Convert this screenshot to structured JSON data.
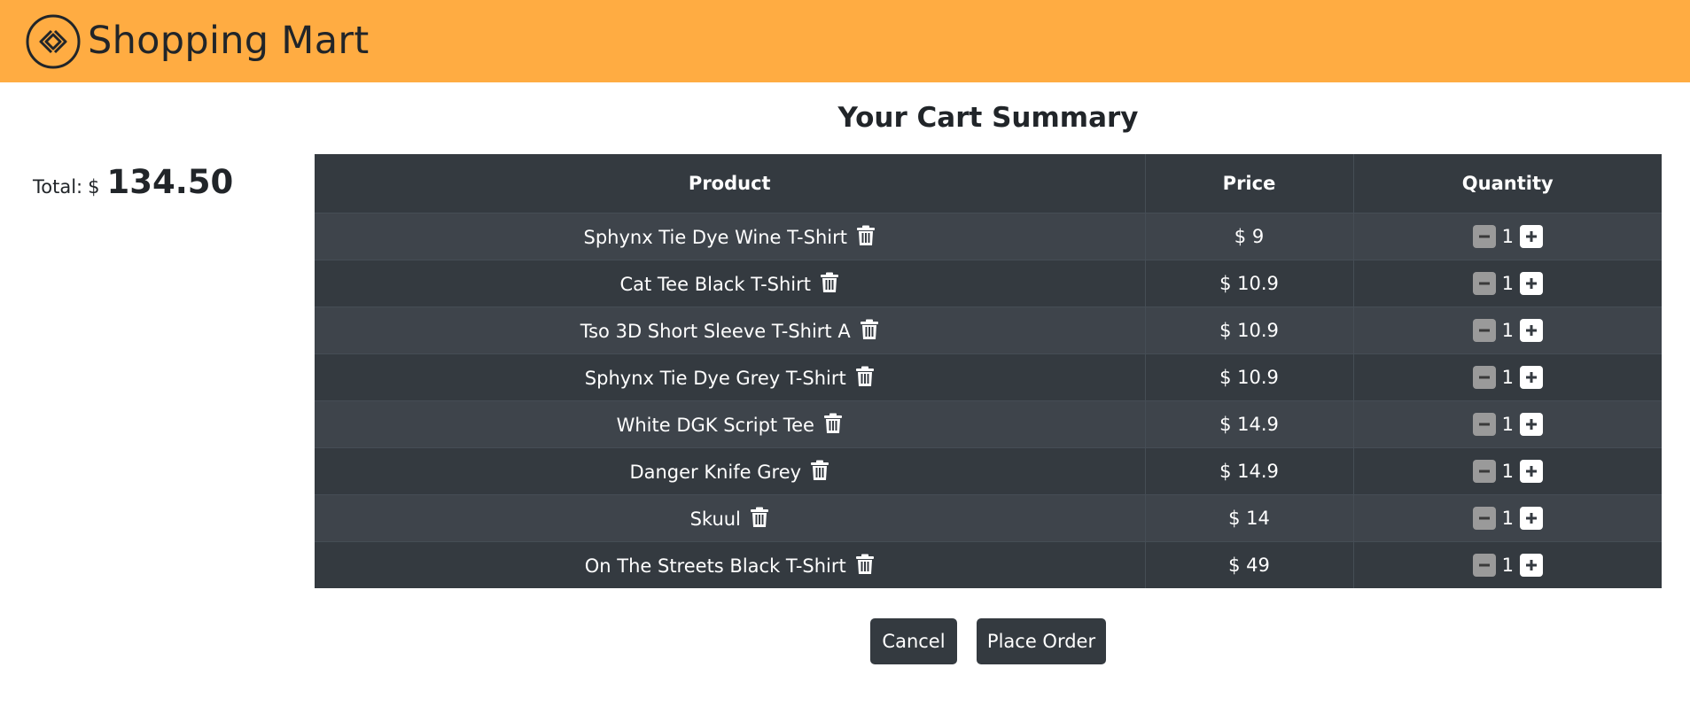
{
  "header": {
    "brand": "Shopping Mart",
    "color": "#ffac42"
  },
  "summary": {
    "title": "Your Cart Summary",
    "total_label": "Total:",
    "currency": "$",
    "total_value": "134.50"
  },
  "table": {
    "columns": [
      "Product",
      "Price",
      "Quantity"
    ],
    "rows": [
      {
        "product": "Sphynx Tie Dye Wine T-Shirt",
        "price": "$ 9",
        "qty": "1"
      },
      {
        "product": "Cat Tee Black T-Shirt",
        "price": "$ 10.9",
        "qty": "1"
      },
      {
        "product": "Tso 3D Short Sleeve T-Shirt A",
        "price": "$ 10.9",
        "qty": "1"
      },
      {
        "product": "Sphynx Tie Dye Grey T-Shirt",
        "price": "$ 10.9",
        "qty": "1"
      },
      {
        "product": "White DGK Script Tee",
        "price": "$ 14.9",
        "qty": "1"
      },
      {
        "product": "Danger Knife Grey",
        "price": "$ 14.9",
        "qty": "1"
      },
      {
        "product": "Skuul",
        "price": "$ 14",
        "qty": "1"
      },
      {
        "product": "On The Streets Black T-Shirt",
        "price": "$ 49",
        "qty": "1"
      }
    ],
    "icons": {
      "delete": "trash-icon",
      "decrease": "minus-icon",
      "increase": "plus-icon"
    }
  },
  "actions": {
    "cancel": "Cancel",
    "place_order": "Place Order"
  }
}
